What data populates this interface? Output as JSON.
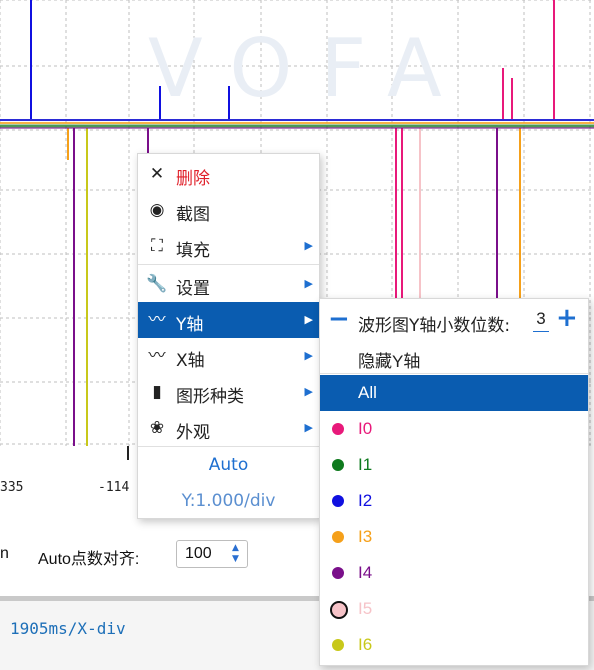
{
  "plot": {
    "background_color": "#ffffff",
    "grid_color": "#bfbfbf",
    "baseline_color": "#2b2bd6",
    "watermark_text": "VOFA",
    "x_tick_labels": [
      "335",
      "-114"
    ]
  },
  "context_menu": {
    "items": [
      {
        "icon": "close-icon",
        "glyph": "✕",
        "label": "删除",
        "color": "#e0202a",
        "has_submenu": false
      },
      {
        "icon": "screenshot-icon",
        "glyph": "◉",
        "label": "截图",
        "color": "#222222",
        "has_submenu": false
      },
      {
        "icon": "fill-icon",
        "glyph": "⛶",
        "label": "填充",
        "color": "#222222",
        "has_submenu": true
      },
      {
        "icon": "wrench-icon",
        "glyph": "🔧",
        "label": "设置",
        "color": "#222222",
        "has_submenu": true
      },
      {
        "icon": "y-axis-wave-icon",
        "glyph": "〰",
        "label": "Y轴",
        "color": "#ffffff",
        "has_submenu": true
      },
      {
        "icon": "x-axis-wave-icon",
        "glyph": "〰",
        "label": "X轴",
        "color": "#222222",
        "has_submenu": true
      },
      {
        "icon": "bar-chart-icon",
        "glyph": "▮",
        "label": "图形种类",
        "color": "#222222",
        "has_submenu": true
      },
      {
        "icon": "appearance-icon",
        "glyph": "❀",
        "label": "外观",
        "color": "#222222",
        "has_submenu": true
      }
    ],
    "auto_label": "Auto",
    "y_scale": "Y:1.000/div",
    "accent_color": "#1e6fd0",
    "active_color": "#0a5cb0"
  },
  "y_submenu": {
    "decimal_label": "波形图Y轴小数位数:",
    "decimal_value": "3",
    "minus": "−",
    "plus": "+",
    "hide_label": "隐藏Y轴",
    "all_label": "All",
    "channels": [
      {
        "name": "I0",
        "color": "#e8197a"
      },
      {
        "name": "I1",
        "color": "#0f7a1e"
      },
      {
        "name": "I2",
        "color": "#1010e0"
      },
      {
        "name": "I3",
        "color": "#f5a01a"
      },
      {
        "name": "I4",
        "color": "#7a0f8a"
      },
      {
        "name": "I5",
        "color": "#f6c3c8"
      },
      {
        "name": "I6",
        "color": "#c8c81a"
      }
    ]
  },
  "controls": {
    "unit_fragment": "n",
    "auto_align_label": "Auto点数对齐:",
    "auto_align_value": "100"
  },
  "footer": {
    "time_scale": "1905ms/X-div"
  }
}
